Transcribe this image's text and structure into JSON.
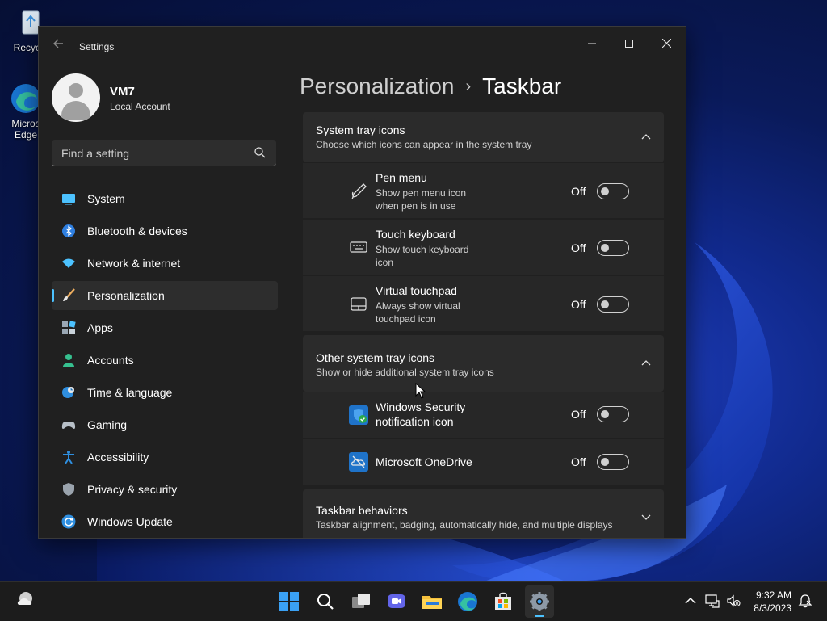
{
  "desktop": {
    "recycle_label": "Recycle",
    "edge_label_1": "Micros",
    "edge_label_2": "Edge"
  },
  "window": {
    "title": "Settings",
    "minimize": "—",
    "maximize": "☐",
    "close": "✕"
  },
  "user": {
    "name": "VM7",
    "account_type": "Local Account"
  },
  "search": {
    "placeholder": "Find a setting"
  },
  "sidebar": {
    "items": [
      {
        "label": "System",
        "icon": "system-icon"
      },
      {
        "label": "Bluetooth & devices",
        "icon": "bluetooth-icon"
      },
      {
        "label": "Network & internet",
        "icon": "wifi-icon"
      },
      {
        "label": "Personalization",
        "icon": "brush-icon",
        "active": true
      },
      {
        "label": "Apps",
        "icon": "apps-icon"
      },
      {
        "label": "Accounts",
        "icon": "person-icon"
      },
      {
        "label": "Time & language",
        "icon": "globe-clock-icon"
      },
      {
        "label": "Gaming",
        "icon": "gamepad-icon"
      },
      {
        "label": "Accessibility",
        "icon": "accessibility-icon"
      },
      {
        "label": "Privacy & security",
        "icon": "shield-icon"
      },
      {
        "label": "Windows Update",
        "icon": "update-icon"
      }
    ]
  },
  "header": {
    "parent": "Personalization",
    "separator": "›",
    "current": "Taskbar"
  },
  "system_tray": {
    "title": "System tray icons",
    "subtitle": "Choose which icons can appear in the system tray",
    "items": [
      {
        "title": "Pen menu",
        "sub1": "Show pen menu icon",
        "sub2": "when pen is in use",
        "state": "Off",
        "icon": "pen-icon"
      },
      {
        "title": "Touch keyboard",
        "sub1": "Show touch keyboard",
        "sub2": "icon",
        "state": "Off",
        "icon": "keyboard-icon"
      },
      {
        "title": "Virtual touchpad",
        "sub1": "Always show virtual",
        "sub2": "touchpad icon",
        "state": "Off",
        "icon": "touchpad-icon"
      }
    ]
  },
  "other_tray": {
    "title": "Other system tray icons",
    "subtitle": "Show or hide additional system tray icons",
    "items": [
      {
        "title1": "Windows Security",
        "title2": "notification icon",
        "state": "Off",
        "icon": "windows-security-icon"
      },
      {
        "title1": "Microsoft OneDrive",
        "state": "Off",
        "icon": "onedrive-icon"
      }
    ]
  },
  "behaviors": {
    "title": "Taskbar behaviors",
    "subtitle": "Taskbar alignment, badging, automatically hide, and multiple displays"
  },
  "taskbar": {
    "time": "9:32 AM",
    "date": "8/3/2023"
  },
  "colors": {
    "accent": "#4cc2ff",
    "window_bg": "#202020",
    "card_bg": "#2b2b2b"
  }
}
